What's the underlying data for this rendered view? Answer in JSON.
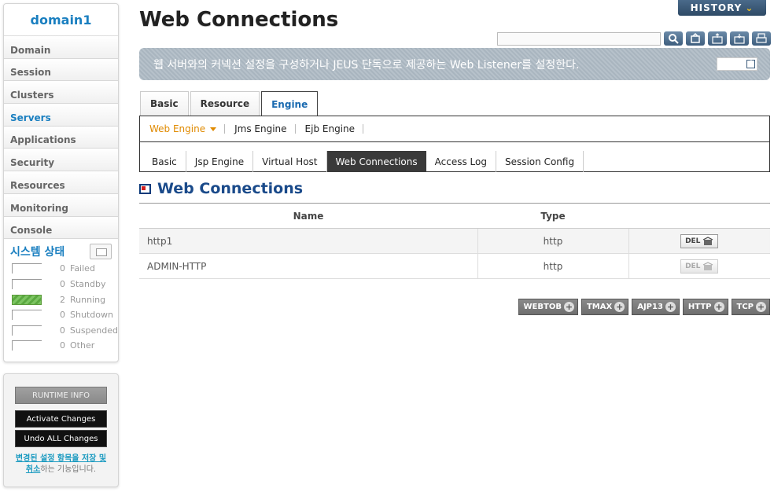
{
  "sidebar": {
    "domain_name": "domain1",
    "nav": [
      "Domain",
      "Session",
      "Clusters",
      "Servers",
      "Applications",
      "Security",
      "Resources",
      "Monitoring",
      "Console"
    ],
    "active_nav": "Servers",
    "system_status": {
      "title": "시스템 상태",
      "rows": [
        {
          "count": "0",
          "label": "Failed"
        },
        {
          "count": "0",
          "label": "Standby"
        },
        {
          "count": "2",
          "label": "Running"
        },
        {
          "count": "0",
          "label": "Shutdown"
        },
        {
          "count": "0",
          "label": "Suspended"
        },
        {
          "count": "0",
          "label": "Other"
        }
      ]
    },
    "runtime_info": "RUNTIME INFO",
    "activate_changes": "Activate Changes",
    "undo_all_changes": "Undo ALL Changes",
    "note_link": "변경된 설정 항목을 저장 및 취소",
    "note_rest": "하는 기능입니다."
  },
  "header": {
    "title": "Web Connections",
    "history": "HISTORY",
    "search_placeholder": "",
    "description": "웹 서버와의 커넥션 설정을 구성하거나 JEUS 단독으로 제공하는 Web Listener를 설정한다.",
    "help": "Help"
  },
  "tabs": {
    "top": [
      "Basic",
      "Resource",
      "Engine"
    ],
    "top_active": "Engine",
    "engines": [
      "Web Engine",
      "Jms Engine",
      "Ejb Engine"
    ],
    "engine_active": "Web Engine",
    "sub": [
      "Basic",
      "Jsp Engine",
      "Virtual Host",
      "Web Connections",
      "Access Log",
      "Session Config"
    ],
    "sub_active": "Web Connections"
  },
  "section": {
    "title": "Web Connections",
    "columns": {
      "name": "Name",
      "type": "Type"
    },
    "rows": [
      {
        "name": "http1",
        "type": "http",
        "action": "DEL",
        "enabled": true
      },
      {
        "name": "ADMIN-HTTP",
        "type": "http",
        "action": "DEL",
        "enabled": false
      }
    ],
    "add_buttons": [
      "WEBTOB",
      "TMAX",
      "AJP13",
      "HTTP",
      "TCP"
    ]
  }
}
